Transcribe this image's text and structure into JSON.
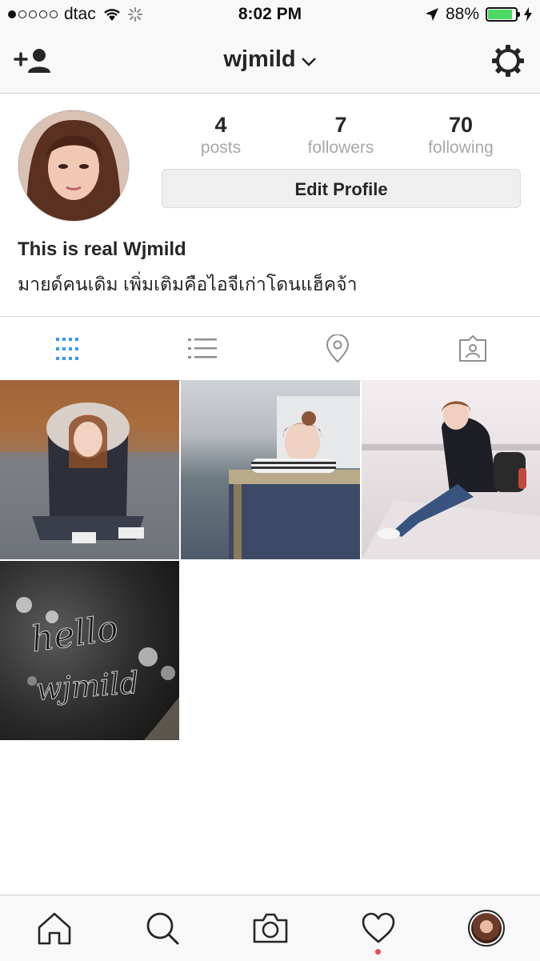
{
  "status_bar": {
    "carrier": "dtac",
    "time": "8:02 PM",
    "battery_percent": "88%",
    "signal_dots_filled": 1,
    "battery_level": 0.88,
    "battery_color": "#4cd964"
  },
  "nav": {
    "username": "wjmild",
    "icons": {
      "left": "add-user-icon",
      "right": "settings-gear-icon",
      "title_suffix": "chevron-down-icon"
    }
  },
  "profile": {
    "stats": [
      {
        "value": "4",
        "label": "posts"
      },
      {
        "value": "7",
        "label": "followers"
      },
      {
        "value": "70",
        "label": "following"
      }
    ],
    "edit_button": "Edit Profile",
    "bio_name": "This is real Wjmild",
    "bio_text": "มายด์คนเดิม เพิ่มเติมคือไอจีเก่าโดนแฮ็คจ้า"
  },
  "tabs": [
    {
      "icon": "grid-view-icon",
      "active": true
    },
    {
      "icon": "list-view-icon",
      "active": false
    },
    {
      "icon": "location-pin-icon",
      "active": false
    },
    {
      "icon": "tagged-photos-icon",
      "active": false
    }
  ],
  "posts": [
    {
      "description": "girl-in-fur-hood-sitting-on-road"
    },
    {
      "description": "girl-leaning-on-railing"
    },
    {
      "description": "girl-sitting-on-seawall"
    },
    {
      "description": "hello-wjmild-written-on-glass"
    }
  ],
  "bottom_bar": [
    {
      "icon": "home-icon"
    },
    {
      "icon": "search-icon"
    },
    {
      "icon": "camera-icon"
    },
    {
      "icon": "heart-icon",
      "has_notification": true
    },
    {
      "icon": "profile-avatar-icon"
    }
  ],
  "colors": {
    "accent": "#3897f0",
    "notification": "#ed4956",
    "text": "#262626",
    "muted": "#a8a8a8"
  }
}
